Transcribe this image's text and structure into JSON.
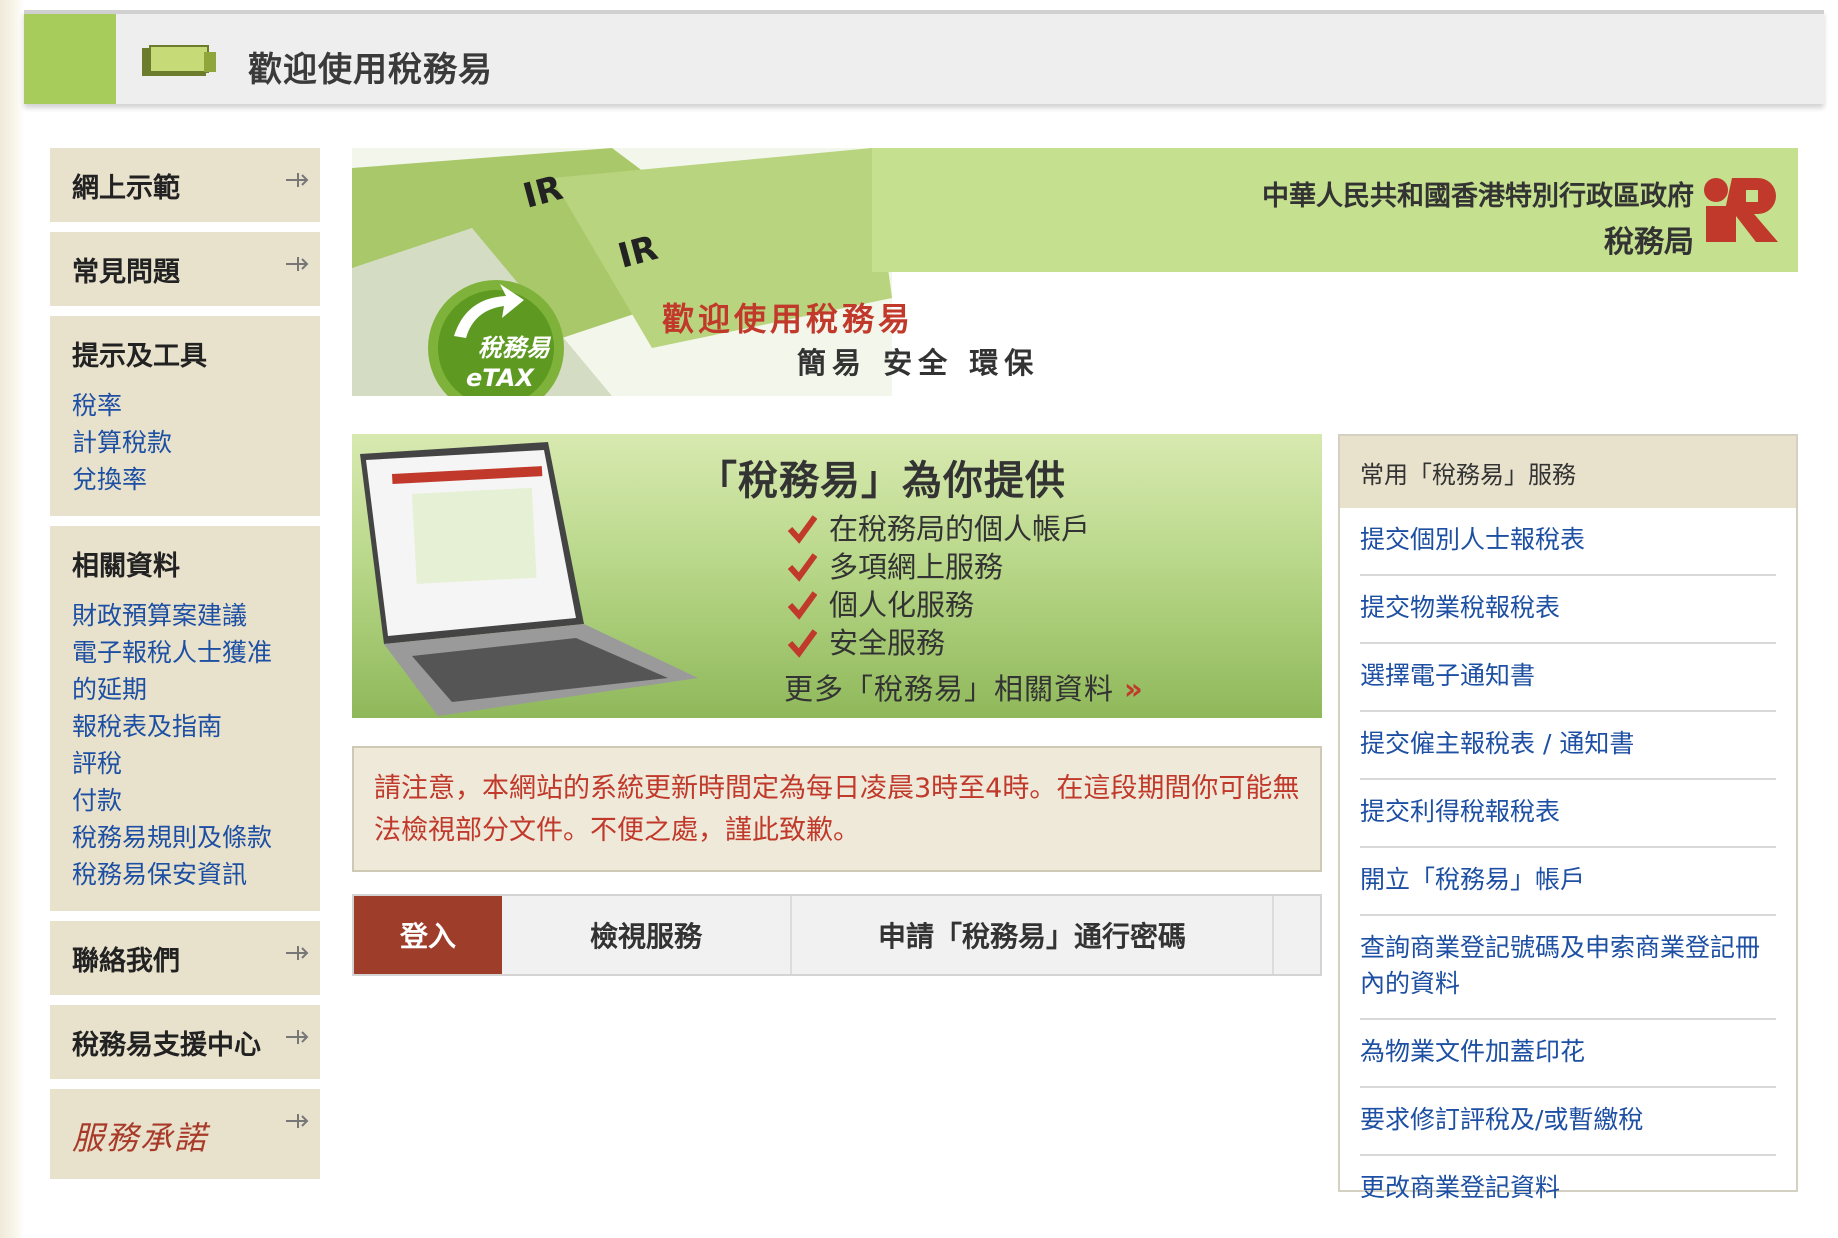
{
  "header": {
    "title": "歡迎使用稅務易"
  },
  "sidebar": {
    "demo": "網上示範",
    "faq": "常見問題",
    "tools": {
      "heading": "提示及工具",
      "links": [
        "稅率",
        "計算稅款",
        "兌換率"
      ]
    },
    "related": {
      "heading": "相關資料",
      "links": [
        "財政預算案建議",
        "電子報稅人士獲准",
        "的延期",
        "報稅表及指南",
        "評稅",
        "付款",
        "稅務易規則及條款",
        "稅務易保安資訊"
      ]
    },
    "contact": "聯絡我們",
    "support": "稅務易支援中心",
    "promise": "服務承諾"
  },
  "banner": {
    "gov_line1": "中華人民共和國香港特別行政區政府",
    "gov_line2": "稅務局",
    "welcome": "歡迎使用稅務易",
    "tagline": "簡易 安全 環保",
    "etax_cn": "稅務易",
    "etax_en": "eTAX"
  },
  "promo": {
    "title": "「稅務易」為你提供",
    "items": [
      "在稅務局的個人帳戶",
      "多項網上服務",
      "個人化服務",
      "安全服務"
    ],
    "more": "更多「稅務易」相關資料"
  },
  "notice": "請注意，本網站的系統更新時間定為每日凌晨3時至4時。在這段期間你可能無法檢視部分文件。不便之處，謹此致歉。",
  "tabs": [
    "登入",
    "檢視服務",
    "申請「稅務易」通行密碼"
  ],
  "services": {
    "heading": "常用「稅務易」服務",
    "items": [
      "提交個別人士報稅表",
      "提交物業稅報稅表",
      "選擇電子通知書",
      "提交僱主報稅表 / 通知書",
      "提交利得稅報稅表",
      "開立「稅務易」帳戶",
      "查詢商業登記號碼及申索商業登記冊內的資料",
      "為物業文件加蓋印花",
      "要求修訂評稅及/或暫繳稅",
      "更改商業登記資料"
    ]
  },
  "colors": {
    "accent_green": "#a8cc5c",
    "tab_active": "#9e3d2a",
    "link": "#1d4fa3",
    "notice_text": "#c0392b",
    "sidebar_bg": "#e8e2cd"
  }
}
